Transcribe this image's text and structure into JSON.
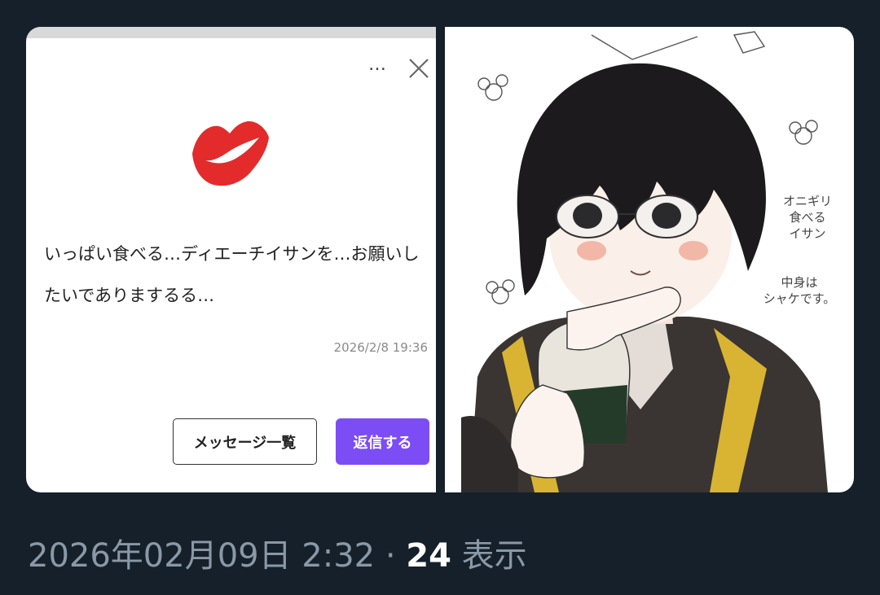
{
  "message_card": {
    "menu_label": "…",
    "message": "いっぱい食べる…ディエーチイサンを…お願いしたいでありまするる…",
    "timestamp": "2026/2/8 19:36",
    "list_button": "メッセージ一覧",
    "reply_button": "返信する",
    "colors": {
      "reply_button": "#7c4df5",
      "lips": "#e32b2b"
    }
  },
  "illustration": {
    "note_1": [
      "オニギリ",
      "食べる",
      "イサン"
    ],
    "note_2": [
      "中身は",
      "シャケです。"
    ]
  },
  "post_meta": {
    "datetime": "2026年02月09日 2:32",
    "separator": " · ",
    "views_count": "24",
    "views_label": " 表示"
  }
}
